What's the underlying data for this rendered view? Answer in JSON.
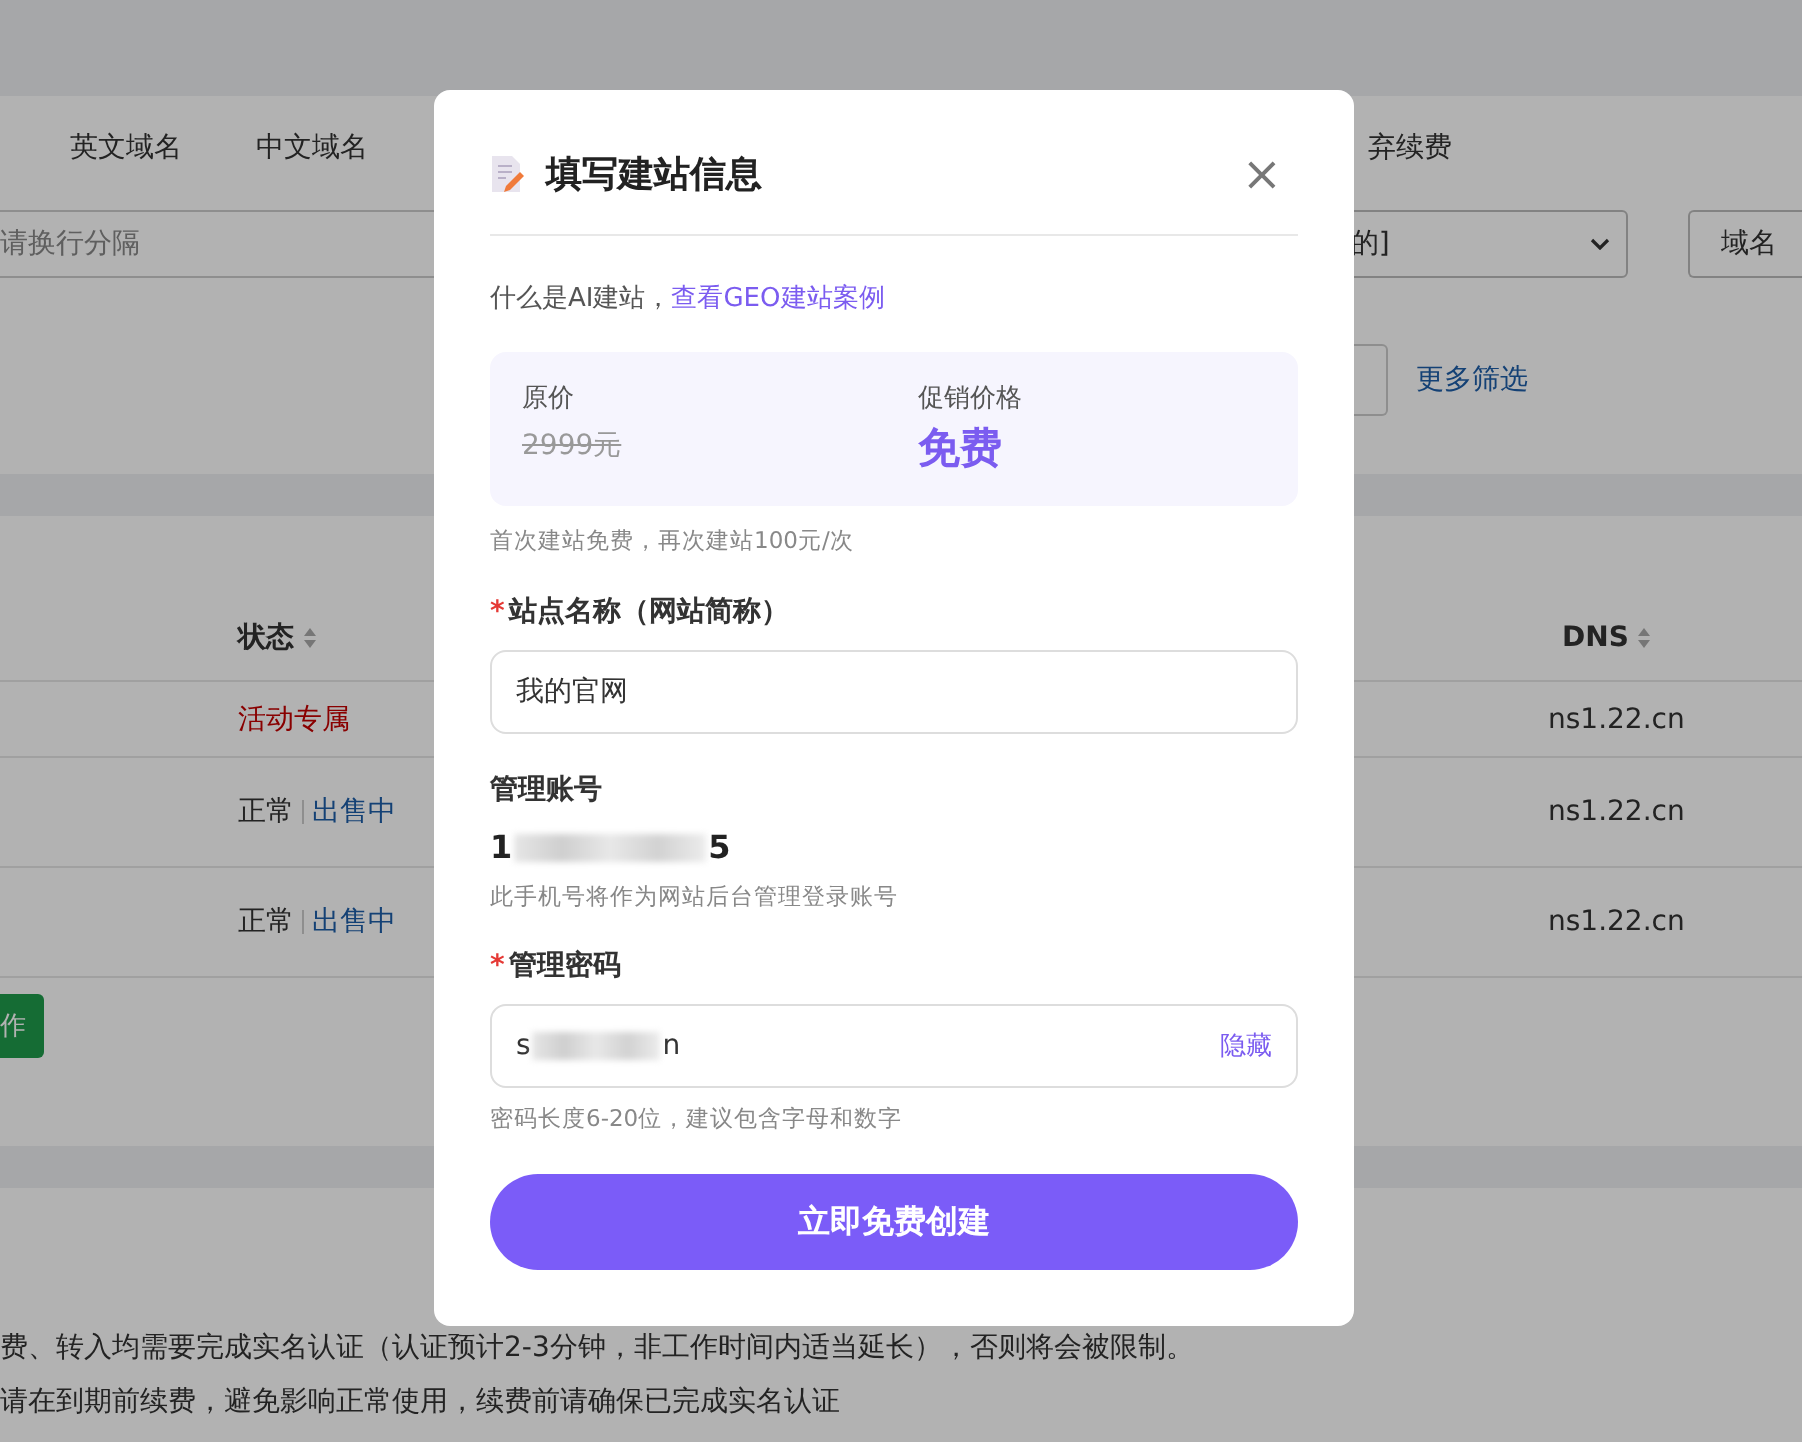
{
  "background": {
    "tabs": [
      {
        "label": "英文域名"
      },
      {
        "label": "中文域名"
      },
      {
        "label": "弃续费"
      }
    ],
    "search": {
      "placeholder": "请换行分隔"
    },
    "select": {
      "value": "的]"
    },
    "search_button": "域名",
    "more_filters": "更多筛选",
    "table": {
      "columns": [
        {
          "label": "状态"
        },
        {
          "label": "DNS"
        }
      ],
      "rows": [
        {
          "status": [
            {
              "text": "活动专属",
              "kind": "promo"
            }
          ],
          "dns": "ns1.22.cn"
        },
        {
          "status": [
            {
              "text": "正常",
              "kind": "plain"
            },
            {
              "text": "出售中",
              "kind": "link"
            }
          ],
          "dns": "ns1.22.cn"
        },
        {
          "status": [
            {
              "text": "正常",
              "kind": "plain"
            },
            {
              "text": "出售中",
              "kind": "link"
            }
          ],
          "dns": "ns1.22.cn"
        }
      ]
    },
    "action_button": "作",
    "notes": [
      "费、转入均需要完成实名认证（认证预计2-3分钟，非工作时间内适当延长），否则将会被限制。",
      "请在到期前续费，避免影响正常使用，续费前请确保已完成实名认证"
    ]
  },
  "dialog": {
    "title": "填写建站信息",
    "close": "×",
    "intro": "什么是AI建站，",
    "intro_link": "查看GEO建站案例",
    "price": {
      "original_label": "原价",
      "original": "2999元",
      "promo_label": "促销价格",
      "promo": "免费"
    },
    "price_note": "首次建站免费，再次建站100元/次",
    "site_name": {
      "mark": "*",
      "label": "站点名称（网站简称）",
      "value": "我的官网"
    },
    "account": {
      "label": "管理账号",
      "value_start": "1",
      "value_end": "5",
      "hint": "此手机号将作为网站后台管理登录账号"
    },
    "password": {
      "mark": "*",
      "label": "管理密码",
      "value_start": "s",
      "value_end": "n",
      "toggle": "隐藏",
      "hint": "密码长度6-20位，建议包含字母和数字"
    },
    "submit": "立即免费创建"
  }
}
